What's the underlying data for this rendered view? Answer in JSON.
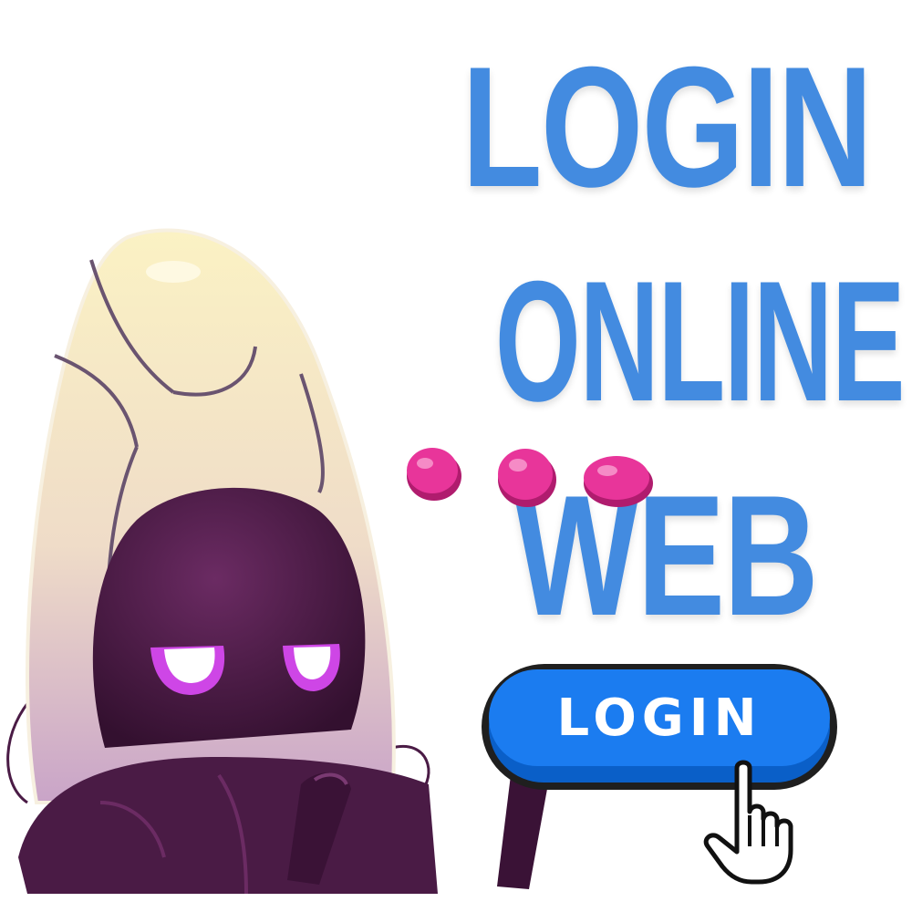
{
  "headline": {
    "line1": "LOGIN",
    "line2": "ONLINE",
    "line3": "WEB"
  },
  "button": {
    "label": "LOGIN"
  },
  "colors": {
    "headline": "#438be0",
    "button": "#1b7cf0",
    "robot_body": "#efe3c8",
    "robot_face": "#4a1b45",
    "robot_eyes": "#e056f0",
    "dots": "#e8359a"
  },
  "icons": [
    "robot-mascot",
    "hand-pointer-icon",
    "pink-dots"
  ]
}
